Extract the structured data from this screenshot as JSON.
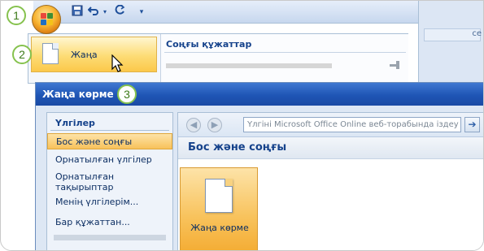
{
  "qat": {
    "save_icon": "save-icon",
    "undo_icon": "undo-icon",
    "redo_icon": "redo-icon",
    "customize_icon": "customize-icon"
  },
  "callouts": [
    "1",
    "2",
    "3"
  ],
  "office_menu": {
    "new_label": "Жаңа",
    "recent_title": "Соңғы құжаттар"
  },
  "app_right": {
    "tab_label": "се"
  },
  "dialog": {
    "title": "Жаңа көрме",
    "left_header": "Үлгілер",
    "left_items": [
      "Бос және соңғы",
      "Орнатылған үлгілер",
      "Орнатылған тақырыптар",
      "Менің үлгілерім...",
      "Бар құжаттан..."
    ],
    "search_placeholder": "Үлгіні Microsoft Office Online веб-торабында іздеу",
    "section_title": "Бос және соңғы",
    "template_label": "Жаңа көрме"
  },
  "colors": {
    "accent": "#1f55b5",
    "selected": "#f8c25b",
    "callout_border": "#86c24e"
  }
}
